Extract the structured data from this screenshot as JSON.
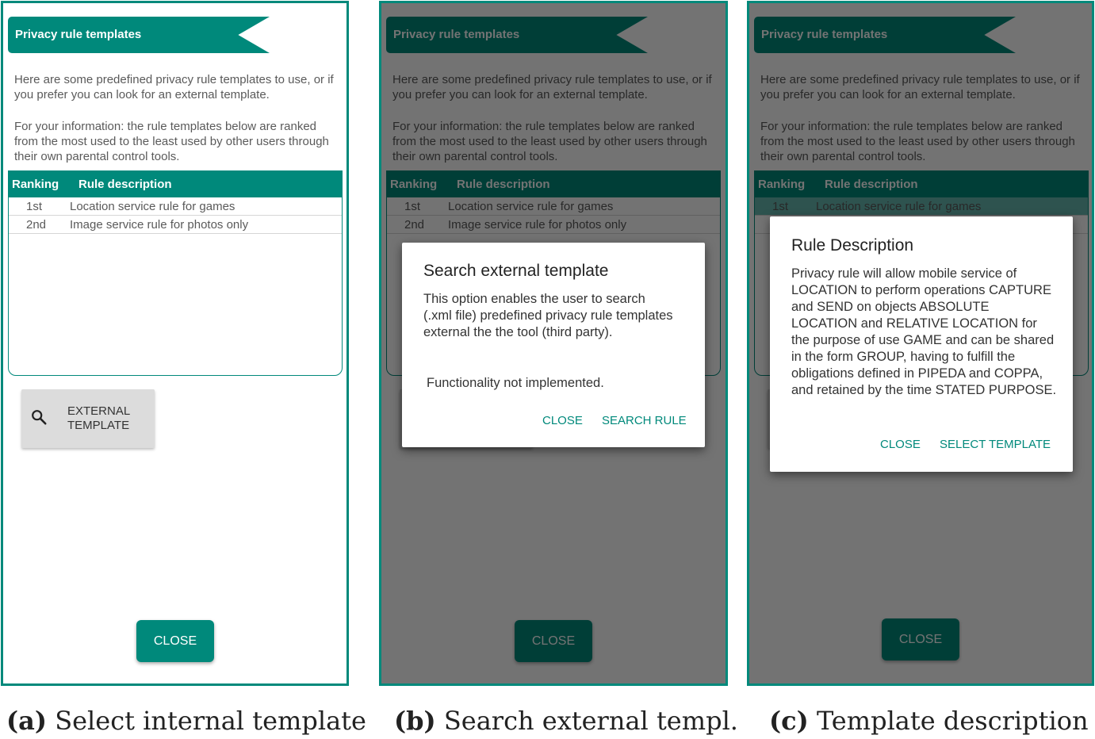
{
  "screen": {
    "banner_title": "Privacy rule templates",
    "intro_text_1": "Here are some predefined privacy rule templates to use, or if you prefer you can look for an external template.",
    "intro_text_2": "For your information: the rule templates below are ranked from the most used to the least used by other users through their own parental control tools.",
    "table": {
      "headers": [
        "Ranking",
        "Rule description"
      ],
      "rows": [
        {
          "ranking": "1st",
          "description": "Location service rule for games"
        },
        {
          "ranking": "2nd",
          "description": "Image service rule for photos only"
        }
      ]
    },
    "external_button_label": "External template",
    "external_button_icon": "search-icon",
    "close_button_label": "Close"
  },
  "dialog_search": {
    "title": "Search external template",
    "body": "This option enables the user to search (.xml file) predefined privacy rule templates external the the tool (third party).",
    "note": "Functionality not implemented.",
    "close_label": "Close",
    "confirm_label": "Search rule"
  },
  "dialog_description": {
    "title": "Rule Description",
    "body": "Privacy rule will allow mobile service of LOCATION to perform operations CAPTURE and SEND on objects ABSOLUTE LOCATION and RELATIVE LOCATION for the purpose of use GAME and can be shared in the form GROUP, having to fulfill the obligations defined in PIPEDA and COPPA, and retained by the time STATED PURPOSE.",
    "close_label": "Close",
    "confirm_label": "Select template"
  },
  "captions": {
    "a_tag": "(a)",
    "a_text": "Select internal template",
    "b_tag": "(b)",
    "b_text": "Search external templ.",
    "c_tag": "(c)",
    "c_text": "Template description"
  },
  "colors": {
    "accent": "#00897b",
    "scrim": "rgba(0,0,0,0.55)"
  }
}
